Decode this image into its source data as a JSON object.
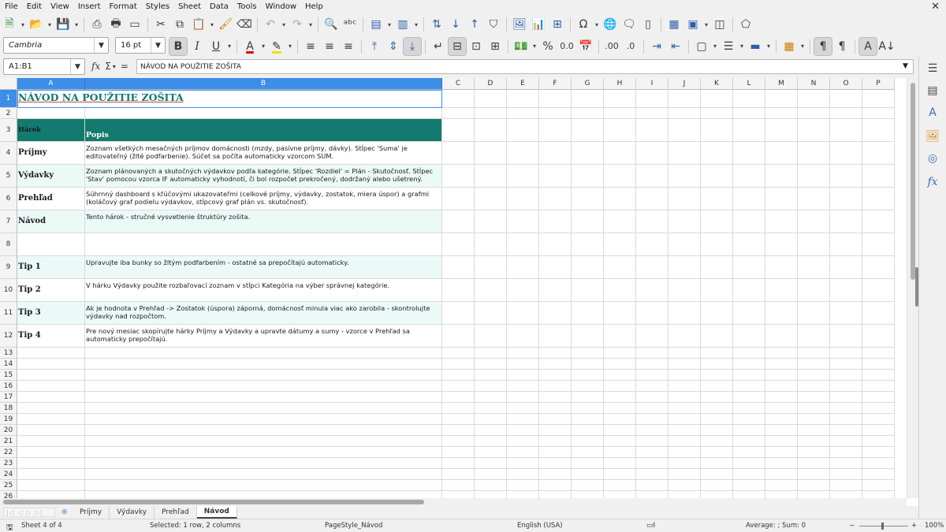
{
  "menu": [
    "File",
    "Edit",
    "View",
    "Insert",
    "Format",
    "Styles",
    "Sheet",
    "Data",
    "Tools",
    "Window",
    "Help"
  ],
  "font": {
    "name": "Cambria",
    "size": "16 pt"
  },
  "formula": {
    "namebox": "A1:B1",
    "content": "NÁVOD NA POUŽITIE ZOŠITA",
    "fx": "fx",
    "sum": "Σ",
    "eq": "="
  },
  "columns": [
    "A",
    "B",
    "C",
    "D",
    "E",
    "F",
    "G",
    "H",
    "I",
    "J",
    "K",
    "L",
    "M",
    "N",
    "O",
    "P"
  ],
  "rows": [
    {
      "num": "1",
      "label": "NÁVOD NA POUŽITIE ZOŠITA",
      "desc": ""
    },
    {
      "num": "2",
      "label": "",
      "desc": ""
    },
    {
      "num": "3",
      "label": "Hárok",
      "desc": "Popis"
    },
    {
      "num": "4",
      "label": "Príjmy",
      "desc": "Zoznam všetkých mesačných príjmov domácnosti (mzdy, pasívne príjmy, dávky). Stĺpec 'Suma' je editovateľný (žlté podfarbenie). Súčet sa počíta automaticky vzorcom SUM."
    },
    {
      "num": "5",
      "label": "Výdavky",
      "desc": "Zoznam plánovaných a skutočných výdavkov podľa kategórie. Stĺpec 'Rozdiel' = Plán - Skutočnosť. Stĺpec 'Stav' pomocou vzorca IF automaticky vyhodnotí, či bol rozpočet prekročený, dodržaný alebo ušetrený."
    },
    {
      "num": "6",
      "label": "Prehľad",
      "desc": "Súhrnný dashboard s kľúčovými ukazovateľmi (celkové príjmy, výdavky, zostatok, miera úspor) a grafmi (koláčový graf podielu výdavkov, stĺpcový graf plán vs. skutočnosť)."
    },
    {
      "num": "7",
      "label": "Návod",
      "desc": "Tento hárok - stručné vysvetlenie štruktúry zošita."
    },
    {
      "num": "8",
      "label": "",
      "desc": ""
    },
    {
      "num": "9",
      "label": "Tip 1",
      "desc": "Upravujte iba bunky so žltým podfarbením - ostatné sa prepočítajú automaticky."
    },
    {
      "num": "10",
      "label": "Tip 2",
      "desc": "V hárku Výdavky použite rozbaľovací zoznam v stĺpci Kategória na výber správnej kategórie."
    },
    {
      "num": "11",
      "label": "Tip 3",
      "desc": "Ak je hodnota v Prehľad -> Zostatok (úspora) záporná, domácnosť minula viac ako zarobila - skontrolujte výdavky nad rozpočtom."
    },
    {
      "num": "12",
      "label": "Tip 4",
      "desc": "Pre nový mesiac skopírujte hárky Príjmy a Výdavky a upravte dátumy a sumy - vzorce v Prehľad sa automaticky prepočítajú."
    },
    {
      "num": "13"
    },
    {
      "num": "14"
    },
    {
      "num": "15"
    },
    {
      "num": "16"
    },
    {
      "num": "17"
    },
    {
      "num": "18"
    },
    {
      "num": "19"
    },
    {
      "num": "20"
    },
    {
      "num": "21"
    },
    {
      "num": "22"
    },
    {
      "num": "23"
    },
    {
      "num": "24"
    },
    {
      "num": "25"
    },
    {
      "num": "26"
    }
  ],
  "tabs": [
    "Príjmy",
    "Výdavky",
    "Prehľad",
    "Návod"
  ],
  "active_tab": "Návod",
  "status": {
    "sheet": "Sheet 4 of 4",
    "selected": "Selected: 1 row, 2 columns",
    "pagestyle": "PageStyle_Návod",
    "language": "English (USA)",
    "summary": "Average: ; Sum: 0",
    "zoom_minus": "−",
    "zoom_plus": "+",
    "zoom": "100%"
  },
  "colors": {
    "header_fill": "#127a6e",
    "title": "#127a6e",
    "selection": "#3c8ee8",
    "alt_row": "#ecfaf7"
  }
}
